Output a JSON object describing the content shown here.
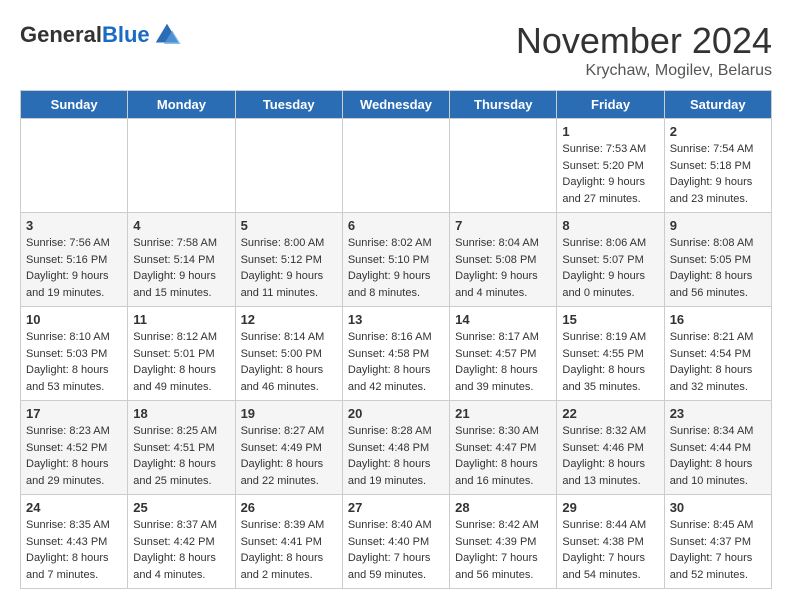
{
  "header": {
    "logo_general": "General",
    "logo_blue": "Blue",
    "month_title": "November 2024",
    "subtitle": "Krychaw, Mogilev, Belarus"
  },
  "weekdays": [
    "Sunday",
    "Monday",
    "Tuesday",
    "Wednesday",
    "Thursday",
    "Friday",
    "Saturday"
  ],
  "weeks": [
    [
      {
        "day": "",
        "info": ""
      },
      {
        "day": "",
        "info": ""
      },
      {
        "day": "",
        "info": ""
      },
      {
        "day": "",
        "info": ""
      },
      {
        "day": "",
        "info": ""
      },
      {
        "day": "1",
        "info": "Sunrise: 7:53 AM\nSunset: 5:20 PM\nDaylight: 9 hours and 27 minutes."
      },
      {
        "day": "2",
        "info": "Sunrise: 7:54 AM\nSunset: 5:18 PM\nDaylight: 9 hours and 23 minutes."
      }
    ],
    [
      {
        "day": "3",
        "info": "Sunrise: 7:56 AM\nSunset: 5:16 PM\nDaylight: 9 hours and 19 minutes."
      },
      {
        "day": "4",
        "info": "Sunrise: 7:58 AM\nSunset: 5:14 PM\nDaylight: 9 hours and 15 minutes."
      },
      {
        "day": "5",
        "info": "Sunrise: 8:00 AM\nSunset: 5:12 PM\nDaylight: 9 hours and 11 minutes."
      },
      {
        "day": "6",
        "info": "Sunrise: 8:02 AM\nSunset: 5:10 PM\nDaylight: 9 hours and 8 minutes."
      },
      {
        "day": "7",
        "info": "Sunrise: 8:04 AM\nSunset: 5:08 PM\nDaylight: 9 hours and 4 minutes."
      },
      {
        "day": "8",
        "info": "Sunrise: 8:06 AM\nSunset: 5:07 PM\nDaylight: 9 hours and 0 minutes."
      },
      {
        "day": "9",
        "info": "Sunrise: 8:08 AM\nSunset: 5:05 PM\nDaylight: 8 hours and 56 minutes."
      }
    ],
    [
      {
        "day": "10",
        "info": "Sunrise: 8:10 AM\nSunset: 5:03 PM\nDaylight: 8 hours and 53 minutes."
      },
      {
        "day": "11",
        "info": "Sunrise: 8:12 AM\nSunset: 5:01 PM\nDaylight: 8 hours and 49 minutes."
      },
      {
        "day": "12",
        "info": "Sunrise: 8:14 AM\nSunset: 5:00 PM\nDaylight: 8 hours and 46 minutes."
      },
      {
        "day": "13",
        "info": "Sunrise: 8:16 AM\nSunset: 4:58 PM\nDaylight: 8 hours and 42 minutes."
      },
      {
        "day": "14",
        "info": "Sunrise: 8:17 AM\nSunset: 4:57 PM\nDaylight: 8 hours and 39 minutes."
      },
      {
        "day": "15",
        "info": "Sunrise: 8:19 AM\nSunset: 4:55 PM\nDaylight: 8 hours and 35 minutes."
      },
      {
        "day": "16",
        "info": "Sunrise: 8:21 AM\nSunset: 4:54 PM\nDaylight: 8 hours and 32 minutes."
      }
    ],
    [
      {
        "day": "17",
        "info": "Sunrise: 8:23 AM\nSunset: 4:52 PM\nDaylight: 8 hours and 29 minutes."
      },
      {
        "day": "18",
        "info": "Sunrise: 8:25 AM\nSunset: 4:51 PM\nDaylight: 8 hours and 25 minutes."
      },
      {
        "day": "19",
        "info": "Sunrise: 8:27 AM\nSunset: 4:49 PM\nDaylight: 8 hours and 22 minutes."
      },
      {
        "day": "20",
        "info": "Sunrise: 8:28 AM\nSunset: 4:48 PM\nDaylight: 8 hours and 19 minutes."
      },
      {
        "day": "21",
        "info": "Sunrise: 8:30 AM\nSunset: 4:47 PM\nDaylight: 8 hours and 16 minutes."
      },
      {
        "day": "22",
        "info": "Sunrise: 8:32 AM\nSunset: 4:46 PM\nDaylight: 8 hours and 13 minutes."
      },
      {
        "day": "23",
        "info": "Sunrise: 8:34 AM\nSunset: 4:44 PM\nDaylight: 8 hours and 10 minutes."
      }
    ],
    [
      {
        "day": "24",
        "info": "Sunrise: 8:35 AM\nSunset: 4:43 PM\nDaylight: 8 hours and 7 minutes."
      },
      {
        "day": "25",
        "info": "Sunrise: 8:37 AM\nSunset: 4:42 PM\nDaylight: 8 hours and 4 minutes."
      },
      {
        "day": "26",
        "info": "Sunrise: 8:39 AM\nSunset: 4:41 PM\nDaylight: 8 hours and 2 minutes."
      },
      {
        "day": "27",
        "info": "Sunrise: 8:40 AM\nSunset: 4:40 PM\nDaylight: 7 hours and 59 minutes."
      },
      {
        "day": "28",
        "info": "Sunrise: 8:42 AM\nSunset: 4:39 PM\nDaylight: 7 hours and 56 minutes."
      },
      {
        "day": "29",
        "info": "Sunrise: 8:44 AM\nSunset: 4:38 PM\nDaylight: 7 hours and 54 minutes."
      },
      {
        "day": "30",
        "info": "Sunrise: 8:45 AM\nSunset: 4:37 PM\nDaylight: 7 hours and 52 minutes."
      }
    ]
  ]
}
